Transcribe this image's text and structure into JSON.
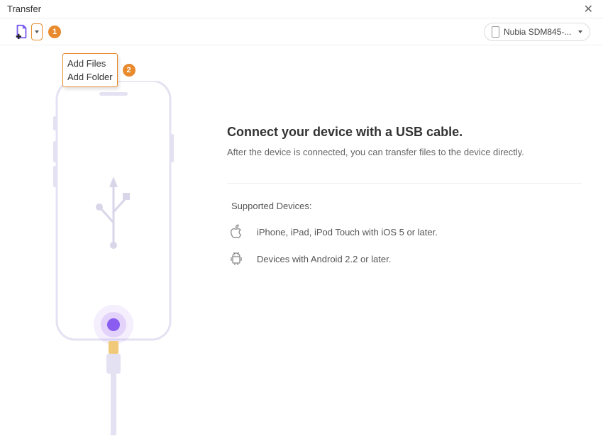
{
  "window": {
    "title": "Transfer"
  },
  "toolbar": {
    "dropdown": {
      "items": [
        "Add Files",
        "Add Folder"
      ]
    },
    "badges": {
      "one": "1",
      "two": "2"
    },
    "device_selected": "Nubia SDM845-..."
  },
  "main": {
    "headline": "Connect your device with a USB cable.",
    "subline": "After the device is connected, you can transfer files to the device directly.",
    "supported_label": "Supported Devices:",
    "apple_text": "iPhone, iPad, iPod Touch with iOS 5 or later.",
    "android_text": "Devices with Android 2.2 or later."
  }
}
